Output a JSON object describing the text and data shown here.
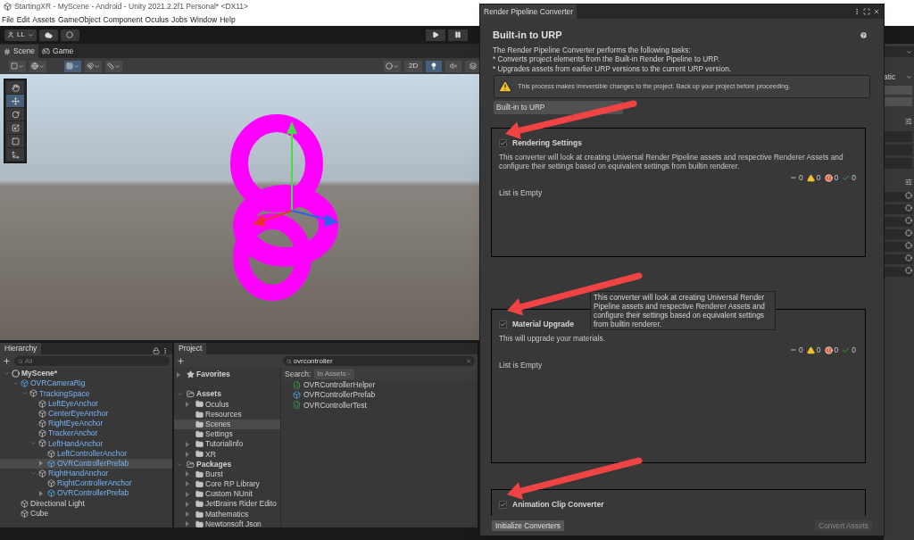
{
  "window": {
    "title": "StartingXR - MyScene - Android - Unity 2021.2.2f1 Personal* <DX11>"
  },
  "menu": [
    "File",
    "Edit",
    "Assets",
    "GameObject",
    "Component",
    "Oculus",
    "Jobs",
    "Window",
    "Help"
  ],
  "toolbar": {
    "account": "LL"
  },
  "view_tabs": [
    {
      "label": "Scene",
      "kind": "scene",
      "selected": true
    },
    {
      "label": "Game",
      "kind": "game",
      "selected": false
    }
  ],
  "scene_toolbar": {
    "mode_2d": "2D",
    "lighting_on": true
  },
  "tools": [
    {
      "kind": "hand",
      "selected": false
    },
    {
      "kind": "move",
      "selected": true
    },
    {
      "kind": "rotate",
      "selected": false
    },
    {
      "kind": "scale",
      "selected": false
    },
    {
      "kind": "rect",
      "selected": false
    },
    {
      "kind": "transform",
      "selected": false
    }
  ],
  "hierarchy": {
    "tab": "Hierarchy",
    "search_placeholder": "All",
    "items": [
      {
        "name": "MyScene*",
        "kind": "scene",
        "expanded": true,
        "selected": false,
        "children": [
          {
            "name": "OVRCameraRig",
            "kind": "prefab",
            "expanded": true,
            "selected": false,
            "children": [
              {
                "name": "TrackingSpace",
                "kind": "object",
                "expanded": true,
                "selected": false,
                "children": [
                  {
                    "name": "LeftEyeAnchor",
                    "kind": "object",
                    "selected": false
                  },
                  {
                    "name": "CenterEyeAnchor",
                    "kind": "object",
                    "selected": false
                  },
                  {
                    "name": "RightEyeAnchor",
                    "kind": "object",
                    "selected": false
                  },
                  {
                    "name": "TrackerAnchor",
                    "kind": "object",
                    "selected": false
                  },
                  {
                    "name": "LeftHandAnchor",
                    "kind": "object",
                    "expanded": true,
                    "selected": false,
                    "children": [
                      {
                        "name": "LeftControllerAnchor",
                        "kind": "object",
                        "selected": false
                      },
                      {
                        "name": "OVRControllerPrefab",
                        "kind": "prefab",
                        "expanded": false,
                        "selected": true
                      }
                    ]
                  },
                  {
                    "name": "RightHandAnchor",
                    "kind": "object",
                    "expanded": true,
                    "selected": false,
                    "children": [
                      {
                        "name": "RightControllerAnchor",
                        "kind": "object",
                        "selected": false
                      },
                      {
                        "name": "OVRControllerPrefab",
                        "kind": "prefab",
                        "expanded": false,
                        "selected": false
                      }
                    ]
                  }
                ]
              }
            ]
          },
          {
            "name": "Directional Light",
            "kind": "plain",
            "selected": false
          },
          {
            "name": "Cube",
            "kind": "plain",
            "selected": false
          }
        ]
      }
    ]
  },
  "project": {
    "tab": "Project",
    "search_value": "ovrcontroller",
    "search_label": "Search:",
    "search_scope": "In Assets",
    "tree": [
      {
        "name": "Favorites",
        "kind": "favorites",
        "expanded": false,
        "selected": false
      },
      {
        "name": "Assets",
        "kind": "folder",
        "expanded": true,
        "selected": false,
        "children": [
          {
            "name": "Oculus",
            "kind": "folder",
            "expanded": false,
            "selected": false
          },
          {
            "name": "Resources",
            "kind": "folder",
            "selected": false
          },
          {
            "name": "Scenes",
            "kind": "folder",
            "selected": true
          },
          {
            "name": "Settings",
            "kind": "folder",
            "selected": false
          },
          {
            "name": "TutorialInfo",
            "kind": "folder",
            "expanded": false,
            "selected": false
          },
          {
            "name": "XR",
            "kind": "folder",
            "expanded": false,
            "selected": false
          }
        ]
      },
      {
        "name": "Packages",
        "kind": "folder",
        "expanded": true,
        "selected": false,
        "children": [
          {
            "name": "Burst",
            "kind": "folder",
            "expanded": false,
            "selected": false
          },
          {
            "name": "Core RP Library",
            "kind": "folder",
            "expanded": false,
            "selected": false
          },
          {
            "name": "Custom NUnit",
            "kind": "folder",
            "expanded": false,
            "selected": false
          },
          {
            "name": "JetBrains Rider Edito",
            "kind": "folder",
            "expanded": false,
            "selected": false
          },
          {
            "name": "Mathematics",
            "kind": "folder",
            "expanded": false,
            "selected": false
          },
          {
            "name": "Newtonsoft Json",
            "kind": "folder",
            "expanded": false,
            "selected": false
          }
        ]
      }
    ],
    "results": [
      {
        "name": "OVRControllerHelper",
        "kind": "script"
      },
      {
        "name": "OVRControllerPrefab",
        "kind": "prefab"
      },
      {
        "name": "OVRControllerTest",
        "kind": "script"
      }
    ]
  },
  "inspector_fragment": {
    "text": "atic"
  },
  "converter": {
    "tab": "Render Pipeline Converter",
    "heading": "Built-in to URP",
    "intro": [
      "The Render Pipeline Converter performs the following tasks:",
      "* Converts project elements from the Built-in Render Pipeline to URP.",
      "* Upgrades assets from earlier URP versions to the current URP version."
    ],
    "warning": "This process makes irreversible changes to the project. Back up your project before proceeding.",
    "dropdown": "Built-in to URP",
    "converters": [
      {
        "title": "Rendering Settings",
        "checked": true,
        "description": "This converter will look at creating Universal Render Pipeline assets and respective Renderer Assets and configure their settings based on equivalent settings from builtin renderer.",
        "counts": [
          {
            "kind": "neutral",
            "value": "0"
          },
          {
            "kind": "warning",
            "value": "0"
          },
          {
            "kind": "error",
            "value": "0"
          },
          {
            "kind": "success",
            "value": "0"
          }
        ],
        "list_text": "List is Empty"
      },
      {
        "title": "Material Upgrade",
        "checked": true,
        "description": "This will upgrade your materials.",
        "counts": [
          {
            "kind": "neutral",
            "value": "0"
          },
          {
            "kind": "warning",
            "value": "0"
          },
          {
            "kind": "error",
            "value": "0"
          },
          {
            "kind": "success",
            "value": "0"
          }
        ],
        "list_text": "List is Empty"
      },
      {
        "title": "Animation Clip Converter",
        "checked": true
      }
    ],
    "tooltip": "This converter will look at creating Universal Render Pipeline assets and respective Renderer Assets and configure their settings based on equivalent settings from builtin renderer.",
    "buttons": [
      {
        "label": "Initialize Converters",
        "disabled": false
      },
      {
        "label": "Convert Assets",
        "disabled": true
      }
    ]
  }
}
